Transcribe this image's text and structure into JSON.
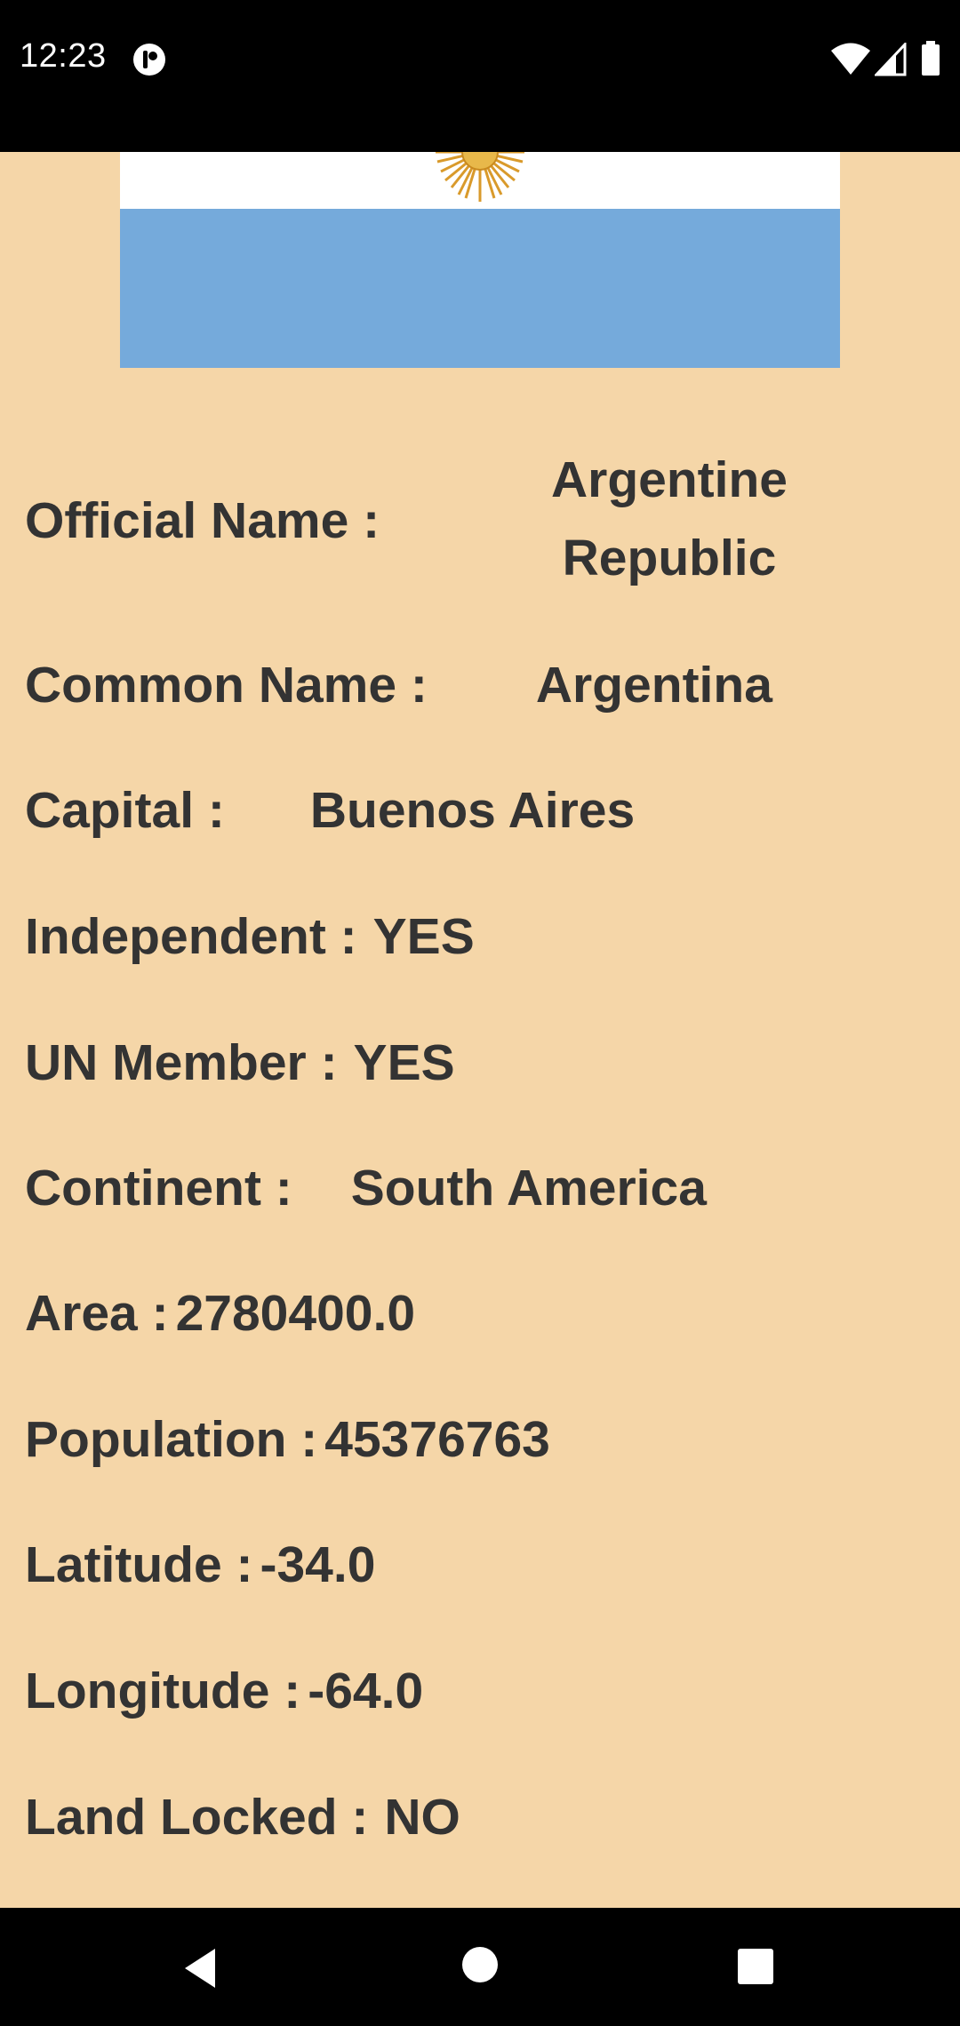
{
  "status_bar": {
    "time": "12:23",
    "icons": [
      "app-notification-icon",
      "wifi-icon",
      "cellular-signal-icon",
      "battery-icon"
    ]
  },
  "flag": {
    "icon": "argentina-flag",
    "colors": {
      "blue": "#75aadb",
      "white": "#ffffff",
      "sun": "#d99a2b"
    }
  },
  "details": {
    "official_name": {
      "label": "Official Name :",
      "value_line1": "Argentine",
      "value_line2": "Republic"
    },
    "common_name": {
      "label": "Common Name :",
      "value": "Argentina"
    },
    "capital": {
      "label": "Capital :",
      "value": "Buenos Aires"
    },
    "independent": {
      "label": "Independent :",
      "value": "YES"
    },
    "un_member": {
      "label": "UN Member :",
      "value": "YES"
    },
    "continent": {
      "label": "Continent :",
      "value": "South America"
    },
    "area": {
      "label": "Area :",
      "value": "2780400.0"
    },
    "population": {
      "label": "Population :",
      "value": "45376763"
    },
    "latitude": {
      "label": "Latitude :",
      "value": "-34.0"
    },
    "longitude": {
      "label": "Longitude :",
      "value": "-64.0"
    },
    "land_locked": {
      "label": "Land Locked :",
      "value": "NO"
    }
  },
  "nav_bar": {
    "icons": [
      "back-icon",
      "home-icon",
      "recents-icon"
    ]
  },
  "colors": {
    "background": "#f5d6a8",
    "text": "#333333",
    "system_bars": "#000000"
  }
}
